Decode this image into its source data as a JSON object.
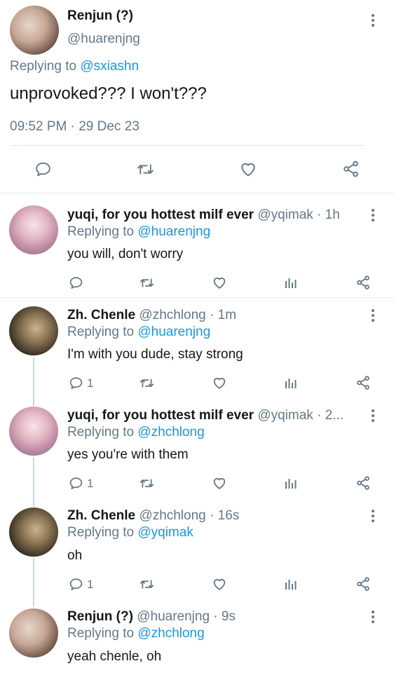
{
  "main_tweet": {
    "name": "Renjun (?)",
    "handle": "@huarenjng",
    "replying_prefix": "Replying to",
    "replying_to": "@sxiashn",
    "text": "unprovoked??? I won't???",
    "timestamp": "09:52 PM · 29 Dec 23"
  },
  "replies": [
    {
      "name": "yuqi, for you hottest milf ever",
      "handle": "@yqimak · 1h",
      "replying_prefix": "Replying to",
      "replying_to": "@huarenjng",
      "text": "you will, don't worry",
      "reply_count": ""
    },
    {
      "name": "Zh. Chenle",
      "handle": "@zhchlong · 1m",
      "replying_prefix": "Replying to",
      "replying_to": "@huarenjng",
      "text": "I'm with you dude, stay strong",
      "reply_count": "1"
    },
    {
      "name": "yuqi, for you hottest milf ever",
      "handle": "@yqimak · 2...",
      "replying_prefix": "Replying to",
      "replying_to": "@zhchlong",
      "text": "yes you're with them",
      "reply_count": "1"
    },
    {
      "name": "Zh. Chenle",
      "handle": "@zhchlong · 16s",
      "replying_prefix": "Replying to",
      "replying_to": "@yqimak",
      "text": "oh",
      "reply_count": "1"
    },
    {
      "name": "Renjun (?)",
      "handle": "@huarenjng · 9s",
      "replying_prefix": "Replying to",
      "replying_to": "@zhchlong",
      "text": "yeah chenle, oh"
    }
  ],
  "icons": {
    "reply": "reply-icon",
    "retweet": "retweet-icon",
    "like": "heart-icon",
    "analytics": "analytics-icon",
    "share": "share-icon",
    "more": "more-options-icon"
  },
  "colors": {
    "link": "#1b95e0",
    "secondary_text": "#657786",
    "divider": "#e1e8ed",
    "thread_line": "#ccd6dd"
  }
}
